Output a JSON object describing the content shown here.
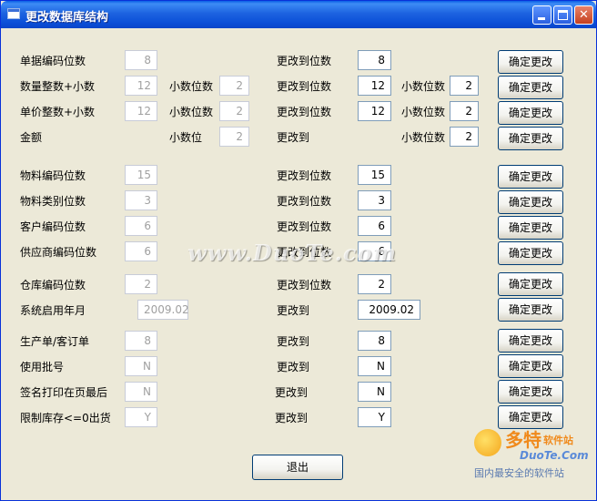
{
  "window": {
    "title": "更改数据库结构",
    "icon": "window-icon",
    "controls": [
      "minimize-icon",
      "maximize-icon",
      "close-icon"
    ]
  },
  "rows": [
    {
      "label": "单据编码位数",
      "current": "8",
      "change_label": "更改到位数",
      "new_value": "8",
      "button": "确定更改"
    },
    {
      "label": "数量整数+小数",
      "current": "12",
      "decimal_label": "小数位数",
      "decimal_current": "2",
      "change_label": "更改到位数",
      "new_value": "12",
      "new_decimal_label": "小数位数",
      "new_decimal_value": "2",
      "button": "确定更改"
    },
    {
      "label": "单价整数+小数",
      "current": "12",
      "decimal_label": "小数位数",
      "decimal_current": "2",
      "change_label": "更改到位数",
      "new_value": "12",
      "new_decimal_label": "小数位数",
      "new_decimal_value": "2",
      "button": "确定更改"
    },
    {
      "label": "金额",
      "decimal_label": "小数位",
      "decimal_current": "2",
      "change_label": "更改到",
      "new_decimal_label": "小数位数",
      "new_decimal_value": "2",
      "button": "确定更改"
    },
    {
      "label": "物料编码位数",
      "current": "15",
      "change_label": "更改到位数",
      "new_value": "15",
      "button": "确定更改"
    },
    {
      "label": "物料类别位数",
      "current": "3",
      "change_label": "更改到位数",
      "new_value": "3",
      "button": "确定更改"
    },
    {
      "label": "客户编码位数",
      "current": "6",
      "change_label": "更改到位数",
      "new_value": "6",
      "button": "确定更改"
    },
    {
      "label": "供应商编码位数",
      "current": "6",
      "change_label": "更改到位数",
      "new_value": "6",
      "button": "确定更改"
    },
    {
      "label": "仓库编码位数",
      "current": "2",
      "change_label": "更改到位数",
      "new_value": "2",
      "button": "确定更改"
    },
    {
      "label": "系统启用年月",
      "current": "2009.02",
      "change_label": "更改到",
      "new_value": "2009.02",
      "button": "确定更改"
    },
    {
      "label": "生产单/客订单",
      "current": "8",
      "change_label": "更改到",
      "new_value": "8",
      "button": "确定更改"
    },
    {
      "label": "使用批号",
      "current": "N",
      "change_label": "更改到",
      "new_value": "N",
      "button": "确定更改"
    },
    {
      "label": "签名打印在页最后",
      "current": "N",
      "change_label": "更改到",
      "new_value": "N",
      "button": "确定更改"
    },
    {
      "label": "限制库存<=0出货",
      "current": "Y",
      "change_label": "更改到",
      "new_value": "Y",
      "button": "确定更改"
    }
  ],
  "exit_button": "退出",
  "watermark": "www.DuoTe.com",
  "logo": {
    "brand": "多特",
    "sub": "软件站",
    "domain": "DuoTe.Com",
    "tagline": "国内最安全的软件站"
  }
}
